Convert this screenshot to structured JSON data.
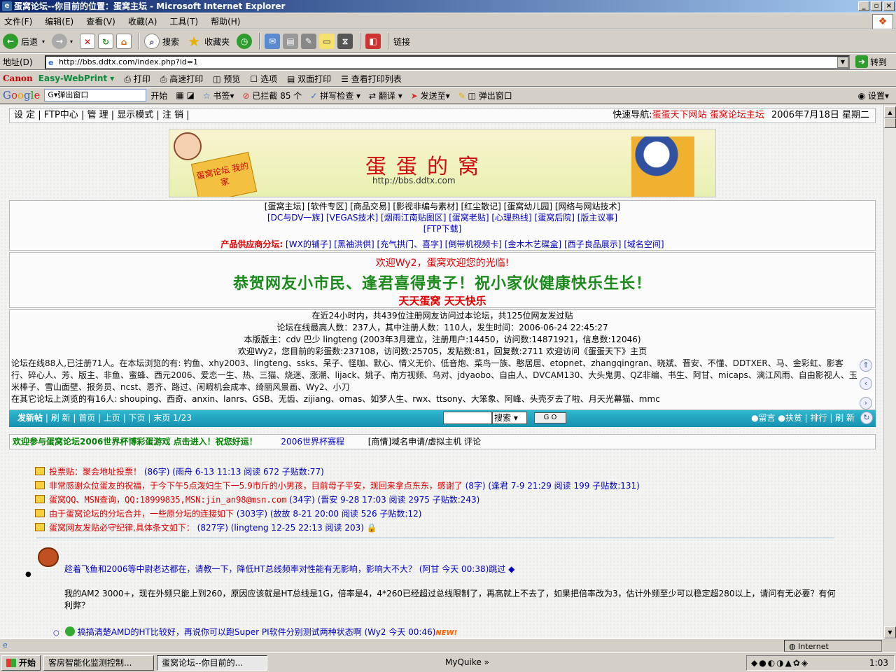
{
  "window": {
    "title": "蛋窝论坛--你目前的位置：蛋窝主坛 - Microsoft Internet Explorer",
    "min": "_",
    "max": "▫",
    "close": "×"
  },
  "menu": [
    "文件(F)",
    "编辑(E)",
    "查看(V)",
    "收藏(A)",
    "工具(T)",
    "帮助(H)"
  ],
  "toolbar": {
    "back": "后退",
    "search": "搜索",
    "favorites": "收藏夹",
    "links": "链接"
  },
  "address": {
    "label": "地址(D)",
    "url": "http://bbs.ddtx.com/index.php?id=1",
    "go": "转到"
  },
  "canon": {
    "brand": "Canon",
    "app": "Easy-WebPrint ▾",
    "print": "打印",
    "fast": "高速打印",
    "preview": "预览",
    "options": "选项",
    "duplex": "双面打印",
    "list": "查看打印列表"
  },
  "google": {
    "logo": "Google",
    "search": "G▾弹出窗口",
    "start": "开始",
    "bookmarks": "书签▾",
    "blocked": "已拦截 85 个",
    "spell": "拼写检查 ▾",
    "translate": "翻译 ▾",
    "send": "发送至▾",
    "popup": "弹出窗口",
    "settings": "设置▾"
  },
  "topnav": {
    "left": "设 定 | FTP中心 | 管 理 | 显示模式 | 注 销 |",
    "quick_label": "快速导航:",
    "site": "蛋蛋天下网站",
    "forum": "蛋窝论坛主坛",
    "date": "2006年7月18日 星期二"
  },
  "banner": {
    "title": "蛋蛋的窝",
    "url": "http://bbs.ddtx.com",
    "sign": "蛋窝论坛 我的家"
  },
  "links": {
    "row1": "[蛋窝主坛] [软件专区] [商品交易] [影视非编与素材] [红尘散记] [蛋窝幼儿园] [网络与网站技术]",
    "row2": "[DC与DV一族] [VEGAS技术] [烟雨江南贴图区] [蛋窝老贴] [心理热线] [蛋窝后院] [版主议事]",
    "row3": "[FTP下载]",
    "supplier_label": "产品供应商分坛:",
    "suppliers": "[WX的铺子] [黑袖洪供] [充气拱门、喜字] [倒带机视频卡] [金木木艺碟盒] [西子良品展示] [域名空间]"
  },
  "welcome": {
    "line1": "欢迎Wy2，蛋窝欢迎您的光临!",
    "line2": "恭贺网友小市民、逢君喜得贵子！祝小家伙健康快乐生长！",
    "line3": "天天蛋窝  天天快乐"
  },
  "stats": {
    "line1": "在近24小时内，共439位注册网友访问过本论坛，共125位网友发过贴",
    "line2": "论坛在线最高人数：237人，其中注册人数：110人，发生时间：2006-06-24 22:45:27",
    "line3": "本版版主：cdv 巴少 lingteng      (2003年3月建立，注册用户:14450，访问数:14871921，信息数:12046)",
    "line4": "欢迎Wy2，您目前的彩蛋数:237108，访问数:25705，发贴数:81，回复数:2711     欢迎访问《蛋蛋天下》主页",
    "online1": "论坛在线88人,已注册71人。在本坛浏览的有: 钓鱼、xhy2003、lingteng、ssks、呆子、怪咖、默心、情义无价、低音炮、菜鸟一族、憨居居、etopnet、zhangqingran、晓斌、晋安、不懂、DDTXER、马、金彩虹、影客行、碎心人、芳、版主、非鱼、蜜蜂、西元2006、爱恋一生、热、三猫、烧迷、涨潮、lijack、姚子、南方视频、乌对、jdyaobo、自由人、DVCAM130、大头鬼男、QZ非编、书生、阿甘、micaps、漓江风雨、自由影视人、玉米棒子、雪山面壁、报务员、ncst、恩齐、路过、闲暇机会成本、绮丽风景画、Wy2、小刀",
    "online2": "在其它论坛上浏览的有16人: shouping、西奇、anxin、lanrs、GSB、无齿、zijiang、omas、如梦人生、rwx、ttsony、大笨象、阿峰、头壳歹去了啦、月天光幕猫、mmc"
  },
  "pagebar": {
    "new": "发新帖",
    "refresh": "| 刷 新 | 首页 | 上页 | 下页 | 末页 1/23",
    "search": "搜索 ▾",
    "go": "G O",
    "right": "●留言 ●扶贫 | 排行 | 刷 新"
  },
  "promo": {
    "left": "欢迎参与蛋窝论坛2006世界杯博彩蛋游戏 点击进入！祝您好运！",
    "mid": "2006世界杯赛程",
    "right": "[商情]域名申请/虚拟主机 评论"
  },
  "threads": [
    {
      "title": "投票贴：聚会地址投票！",
      "meta": "(86字) (雨舟 6-13 11:13 阅读 672 子贴数:77)"
    },
    {
      "title": "非常感谢众位蛋友的祝福，于今下午5点泼妇生下一5.9市斤的小男孩，目前母子平安，现回来拿点东东，感谢了",
      "meta": "(8字) (逢君 7-9 21:29 阅读 199 子贴数:131)"
    },
    {
      "title": "蛋窝QQ、MSN查询，QQ:18999835,MSN:jin_an98@msn.com",
      "meta": "(34字) (晋安 9-28 17:03 阅读 2975 子贴数:243)"
    },
    {
      "title": "由于蛋窝论坛的分坛合并，一些原分坛的连接如下",
      "meta": "(303字) (故故 8-21 20:00 阅读 526 子贴数:12)"
    },
    {
      "title": "蛋窝网友发贴必守纪律,具体条文如下：",
      "meta": "(827字) (lingteng 12-25 22:13 阅读 203)"
    }
  ],
  "post": {
    "title": "趁着飞鱼和2006等中尉老达都在，请教一下，降低HT总线频率对性能有无影响，影响大不大？ (阿甘 今天 00:38)跳过 ◆",
    "body": "我的AM2 3000+，现在外频只能上到260，原因应该就是HT总线是1G，倍率是4，4*260已经超过总线限制了，再高就上不去了，如果把倍率改为3，估计外频至少可以稳定超280以上，请问有无必要？有何利弊？",
    "reply": "搞搞清楚AMD的HT比较好，再说你可以跑Super PI软件分别测试两种状态啊 (Wy2 今天 00:46)",
    "new": "NEW!"
  },
  "status": {
    "zone": "Internet"
  },
  "taskbar": {
    "start": "开始",
    "task1": "客房智能化监测控制...",
    "task2": "蛋窝论坛--你目前的...",
    "quick": "MyQuike »",
    "clock": "1:03"
  }
}
